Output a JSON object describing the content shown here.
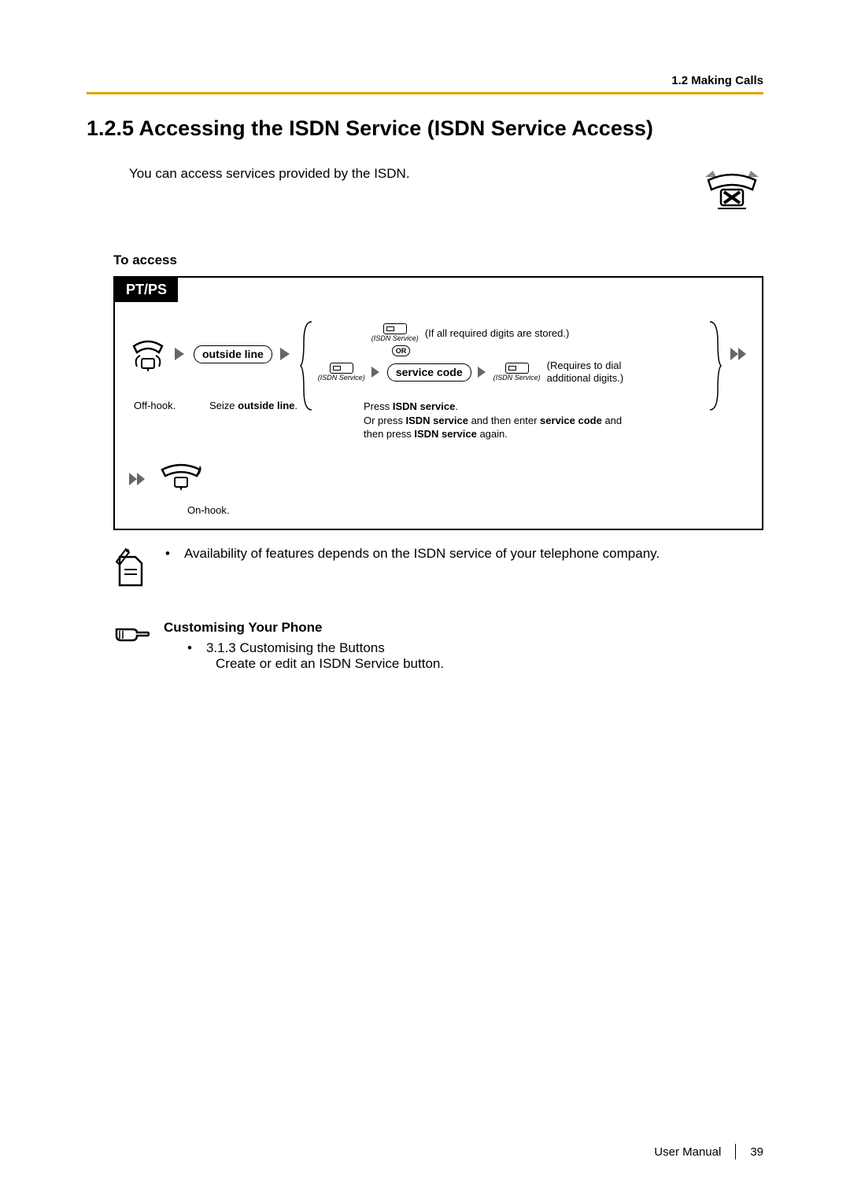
{
  "header": {
    "section": "1.2 Making Calls"
  },
  "title": "1.2.5    Accessing the ISDN Service (ISDN Service Access)",
  "intro": "You can access services provided by the ISDN.",
  "sub_heading": "To access",
  "diagram": {
    "tab": "PT/PS",
    "outside_line": "outside line",
    "service_code": "service code",
    "isdn_label": "(ISDN Service)",
    "or": "OR",
    "annot_top": "(If all required digits are stored.)",
    "annot_bot1": "(Requires to dial",
    "annot_bot2": "additional digits.)",
    "cap_offhook": "Off-hook.",
    "cap_seize_pre": "Seize ",
    "cap_seize_bold": "outside line",
    "cap_seize_post": ".",
    "cap_press_1a": "Press ",
    "cap_press_1b": "ISDN service",
    "cap_press_1c": ".",
    "cap_press_2a": "Or press ",
    "cap_press_2b": "ISDN service",
    "cap_press_2c": " and then enter ",
    "cap_press_2d": "service code",
    "cap_press_2e": " and",
    "cap_press_3a": "then press ",
    "cap_press_3b": "ISDN service",
    "cap_press_3c": " again.",
    "cap_onhook": "On-hook."
  },
  "note": "Availability of features depends on the ISDN service of your telephone company.",
  "customising": {
    "title": "Customising Your Phone",
    "item": "3.1.3 Customising the Buttons",
    "desc": "Create or edit an ISDN Service button."
  },
  "footer": {
    "label": "User Manual",
    "page": "39"
  }
}
